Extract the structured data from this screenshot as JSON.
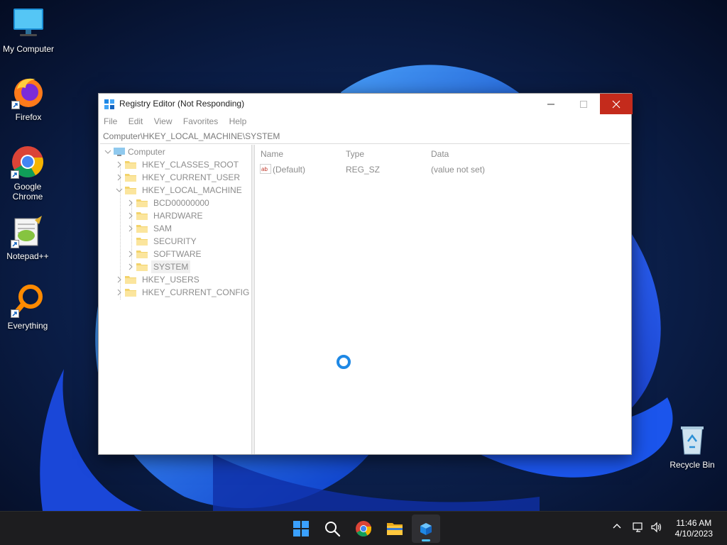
{
  "desktop": {
    "icons": [
      {
        "label": "My Computer"
      },
      {
        "label": "Firefox"
      },
      {
        "label": "Google Chrome"
      },
      {
        "label": "Notepad++"
      },
      {
        "label": "Everything"
      },
      {
        "label": "Recycle Bin"
      }
    ]
  },
  "window": {
    "title": "Registry Editor (Not Responding)",
    "menu": [
      "File",
      "Edit",
      "View",
      "Favorites",
      "Help"
    ],
    "address": "Computer\\HKEY_LOCAL_MACHINE\\SYSTEM",
    "tree": {
      "root": "Computer",
      "hives": [
        "HKEY_CLASSES_ROOT",
        "HKEY_CURRENT_USER",
        "HKEY_LOCAL_MACHINE",
        "HKEY_USERS",
        "HKEY_CURRENT_CONFIG"
      ],
      "hklm_children": [
        "BCD00000000",
        "HARDWARE",
        "SAM",
        "SECURITY",
        "SOFTWARE",
        "SYSTEM"
      ],
      "selected": "SYSTEM"
    },
    "list": {
      "columns": [
        "Name",
        "Type",
        "Data"
      ],
      "rows": [
        {
          "name": "(Default)",
          "type": "REG_SZ",
          "data": "(value not set)",
          "icon": "string-value-icon"
        }
      ]
    },
    "status": "busy-spinner"
  },
  "taskbar": {
    "apps": [
      "start",
      "search",
      "chrome",
      "file-explorer",
      "registry-editor"
    ],
    "active": "registry-editor",
    "clock": {
      "time": "11:46 AM",
      "date": "4/10/2023"
    }
  },
  "colors": {
    "close_button": "#c42b1c",
    "accent": "#4cc2ff",
    "spinner": "#1e88e5"
  }
}
